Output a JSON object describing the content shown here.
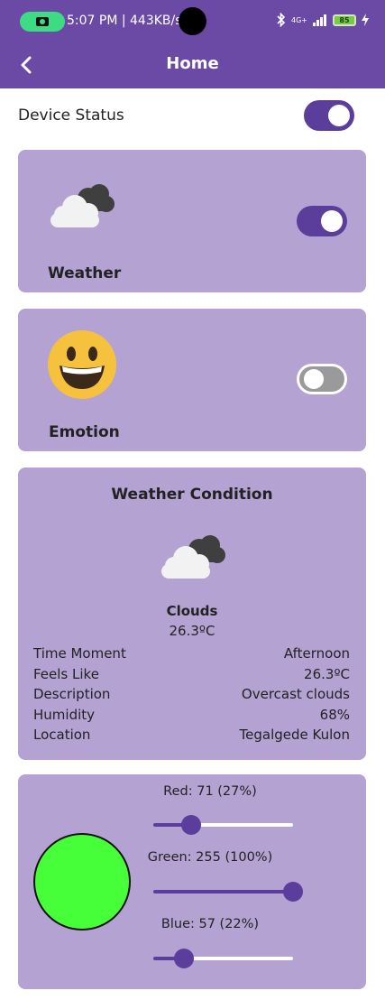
{
  "status_bar": {
    "time_and_speed": "5:07 PM | 443KB/s",
    "network": "4G+",
    "battery": "85"
  },
  "app_bar": {
    "title": "Home"
  },
  "device_status": {
    "label": "Device Status",
    "enabled": true
  },
  "weather_card": {
    "label": "Weather",
    "enabled": true,
    "icon": "clouds-icon"
  },
  "emotion_card": {
    "label": "Emotion",
    "enabled": false,
    "icon": "smiley-face-icon"
  },
  "weather_condition": {
    "title": "Weather Condition",
    "condition": "Clouds",
    "temperature": "26.3ºC",
    "rows": [
      {
        "label": "Time Moment",
        "value": "Afternoon"
      },
      {
        "label": "Feels Like",
        "value": "26.3ºC"
      },
      {
        "label": "Description",
        "value": "Overcast clouds"
      },
      {
        "label": "Humidity",
        "value": "68%"
      },
      {
        "label": "Location",
        "value": "Tegalgede Kulon"
      }
    ]
  },
  "color_picker": {
    "preview_color": "#47ff39",
    "red": {
      "label": "Red: 71 (27%)",
      "fraction": 0.27
    },
    "green": {
      "label": "Green: 255 (100%)",
      "fraction": 1.0
    },
    "blue": {
      "label": "Blue: 57 (22%)",
      "fraction": 0.22
    }
  },
  "colors": {
    "primary": "#6a4aa5",
    "card": "#b4a2d3",
    "accent": "#5b3d9c"
  }
}
